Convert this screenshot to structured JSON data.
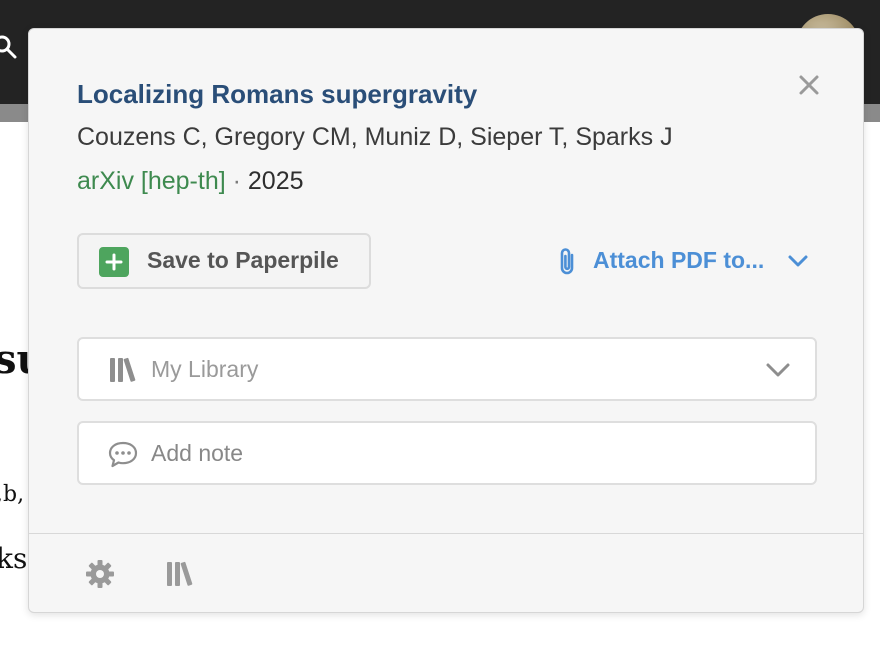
{
  "paper": {
    "title": "Localizing Romans supergravity",
    "authors": "Couzens C, Gregory CM, Muniz D, Sieper T, Sparks J",
    "venue": "arXiv [hep-th]",
    "separator": " · ",
    "year": "2025"
  },
  "actions": {
    "save_label": "Save to Paperpile",
    "attach_label": "Attach PDF to..."
  },
  "library_select": {
    "value": "My Library"
  },
  "note": {
    "placeholder": "Add note"
  },
  "icons": {
    "close": "close-icon",
    "plus": "plus-icon",
    "attach": "paperclip-icon",
    "chevron": "chevron-down-icon",
    "library": "library-books-icon",
    "note": "speech-bubble-icon",
    "settings": "gear-icon"
  },
  "colors": {
    "title": "#2a4e78",
    "venue": "#3e8a4f",
    "accent_blue": "#4c8fd6",
    "save_green": "#4ea55e"
  }
}
